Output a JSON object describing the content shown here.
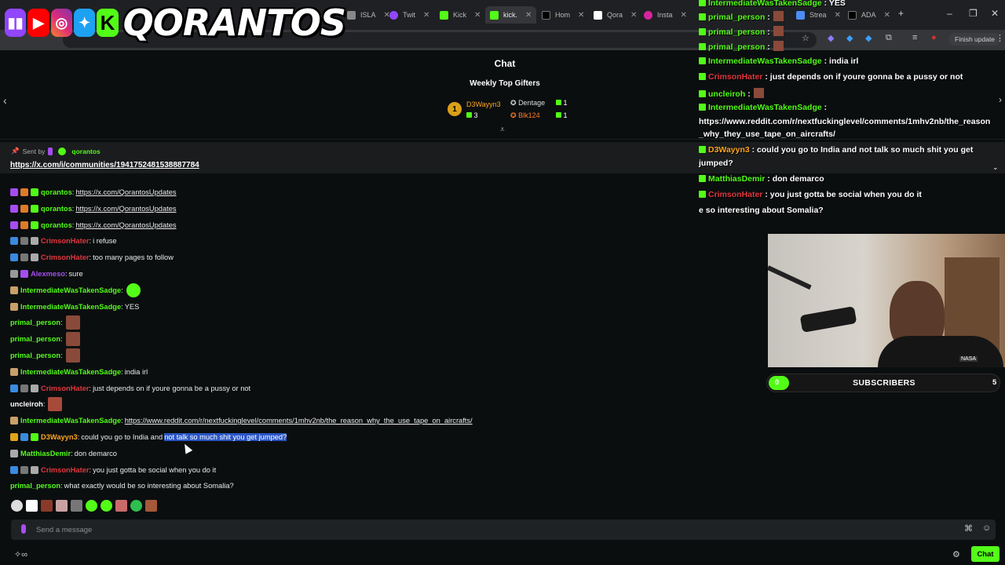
{
  "browser": {
    "tabs": [
      {
        "label": "ISLA"
      },
      {
        "label": "Twit"
      },
      {
        "label": "Kick"
      },
      {
        "label": "kick."
      },
      {
        "label": "Hom"
      },
      {
        "label": "Qora"
      },
      {
        "label": "Insta"
      },
      {
        "label": "Strea"
      },
      {
        "label": "ADA"
      }
    ],
    "finish_update": "Finish update"
  },
  "logo": {
    "brand_text": "QORANTOS",
    "socials": [
      "twitch-icon",
      "youtube-icon",
      "instagram-icon",
      "twitter-icon",
      "kick-icon"
    ]
  },
  "chat": {
    "title": "Chat",
    "weekly_top_gifters": "Weekly Top Gifters",
    "gifters": [
      {
        "rank": "1",
        "name": "D3Wayyn3",
        "count": "3",
        "color": "#ffa621"
      },
      {
        "rank": "",
        "name": "Dentage",
        "count": "1",
        "color": "#dcdcdc"
      },
      {
        "rank": "",
        "name": "Blk124",
        "count": "1",
        "color": "#ff7a2a"
      }
    ],
    "pinned": {
      "sent_by": "Sent by",
      "user": "qorantos",
      "link": "https://x.com/i/communities/1941752481538887784"
    },
    "messages": [
      {
        "user": "qorantos",
        "color": "#53fc18",
        "text": "",
        "link": "https://x.com/QorantosUpdates"
      },
      {
        "user": "qorantos",
        "color": "#53fc18",
        "text": "",
        "link": "https://x.com/QorantosUpdates"
      },
      {
        "user": "qorantos",
        "color": "#53fc18",
        "text": "",
        "link": "https://x.com/QorantosUpdates"
      },
      {
        "user": "CrimsonHater",
        "color": "#e0383e",
        "text": "i refuse",
        "link": ""
      },
      {
        "user": "CrimsonHater",
        "color": "#e0383e",
        "text": "too many pages to follow",
        "link": ""
      },
      {
        "user": "Alexmeso",
        "color": "#a64df0",
        "text": "sure",
        "link": ""
      },
      {
        "user": "IntermediateWasTakenSadge",
        "color": "#53fc18",
        "text": "",
        "link": ""
      },
      {
        "user": "IntermediateWasTakenSadge",
        "color": "#53fc18",
        "text": "YES",
        "link": ""
      },
      {
        "user": "primal_person",
        "color": "#53fc18",
        "text": "",
        "link": ""
      },
      {
        "user": "primal_person",
        "color": "#53fc18",
        "text": "",
        "link": ""
      },
      {
        "user": "primal_person",
        "color": "#53fc18",
        "text": "",
        "link": ""
      },
      {
        "user": "IntermediateWasTakenSadge",
        "color": "#53fc18",
        "text": "india irl",
        "link": ""
      },
      {
        "user": "CrimsonHater",
        "color": "#e0383e",
        "text": "just depends on if youre gonna be a pussy or not",
        "link": ""
      },
      {
        "user": "uncleiroh",
        "color": "#ffffff",
        "text": "",
        "link": ""
      },
      {
        "user": "IntermediateWasTakenSadge",
        "color": "#53fc18",
        "text": "",
        "link": "https://www.reddit.com/r/nextfuckinglevel/comments/1mhv2nb/the_reason_why_the_use_tape_on_aircrafts/"
      },
      {
        "user": "D3Wayyn3",
        "color": "#ffa621",
        "text": "could you go to India and",
        "highlight": "not talk so much shit you get jumped?",
        "link": ""
      },
      {
        "user": "MatthiasDemir",
        "color": "#53fc18",
        "text": "don demarco",
        "link": ""
      },
      {
        "user": "CrimsonHater",
        "color": "#e0383e",
        "text": "you just gotta be social when you do it",
        "link": ""
      },
      {
        "user": "primal_person",
        "color": "#53fc18",
        "text": "what exactly would be so interesting about Somalia?",
        "link": ""
      }
    ],
    "input_placeholder": "Send a message",
    "chat_button": "Chat"
  },
  "overlay": {
    "lines": [
      {
        "user": "IntermediateWasTakenSadge",
        "class": "ov-user",
        "text": ": YES"
      },
      {
        "user": "primal_person",
        "class": "ov-user",
        "text": ":"
      },
      {
        "user": "primal_person",
        "class": "ov-user",
        "text": ":"
      },
      {
        "user": "primal_person",
        "class": "ov-user",
        "text": ":"
      },
      {
        "user": "IntermediateWasTakenSadge",
        "class": "ov-user",
        "text": ": india irl"
      },
      {
        "user": "CrimsonHater",
        "class": "ov-red",
        "text": ": just depends on if youre gonna be a pussy or not"
      },
      {
        "user": "uncleiroh",
        "class": "ov-user",
        "text": ":"
      },
      {
        "user": "IntermediateWasTakenSadge",
        "class": "ov-user",
        "text": ":"
      },
      {
        "user": "",
        "class": "",
        "text": "https://www.reddit.com/r/nextfuckinglevel/comments/1mhv2nb/the_reason"
      },
      {
        "user": "",
        "class": "",
        "text": "_why_they_use_tape_on_aircrafts/"
      },
      {
        "user": "D3Wayyn3",
        "class": "ov-orange",
        "text": ": could you go to India and not talk so much shit you get"
      },
      {
        "user": "",
        "class": "",
        "text": "jumped?"
      },
      {
        "user": "MatthiasDemir",
        "class": "ov-user",
        "text": ": don demarco"
      },
      {
        "user": "CrimsonHater",
        "class": "ov-red",
        "text": ": you just gotta be social when you do it"
      },
      {
        "user": "",
        "class": "",
        "text": "e so interesting about Somalia?"
      }
    ]
  },
  "webcam": {
    "overlay_text": "NASA"
  },
  "subgoal": {
    "label": "SUBSCRIBERS",
    "current": "0",
    "goal": "5",
    "progress": 0
  },
  "colors": {
    "kick_green": "#53fc18",
    "highlight_blue": "#2a56c6",
    "bg": "#0b0e0f"
  }
}
